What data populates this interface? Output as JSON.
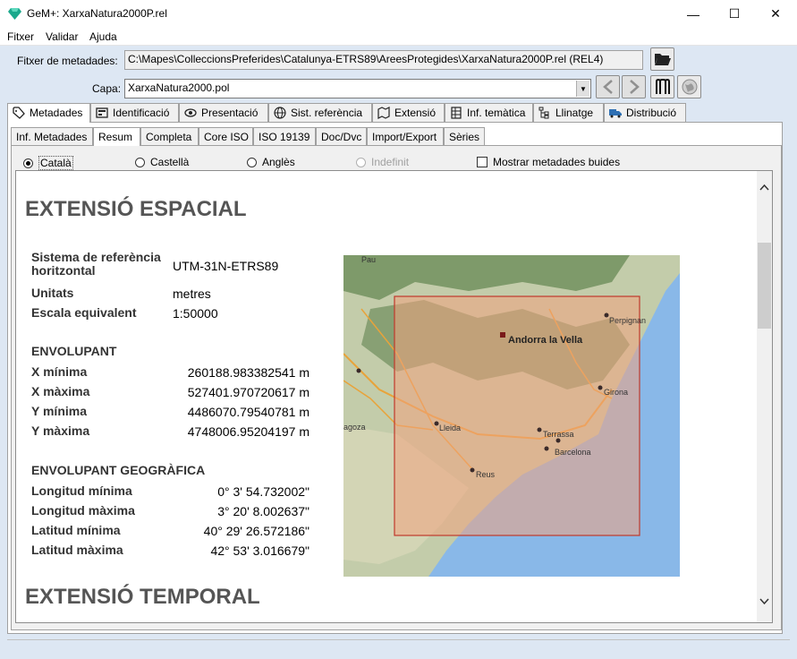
{
  "window": {
    "title": "GeM+: XarxaNatura2000P.rel",
    "minimize": "—",
    "maximize": "☐",
    "close": "✕"
  },
  "menu": [
    "Fitxer",
    "Validar",
    "Ajuda"
  ],
  "metadata_file": {
    "label": "Fitxer de metadades:",
    "value": "C:\\Mapes\\ColleccionsPreferides\\Catalunya-ETRS89\\AreesProtegides\\XarxaNatura2000P.rel (REL4)"
  },
  "layer": {
    "label": "Capa:",
    "value": "XarxaNatura2000.pol"
  },
  "tabs_main": [
    {
      "label": "Metadades",
      "icon": "tag-icon"
    },
    {
      "label": "Identificació",
      "icon": "id-card-icon"
    },
    {
      "label": "Presentació",
      "icon": "eye-icon"
    },
    {
      "label": "Sist. referència",
      "icon": "globe-icon"
    },
    {
      "label": "Extensió",
      "icon": "map-icon"
    },
    {
      "label": "Inf. temàtica",
      "icon": "table-icon"
    },
    {
      "label": "Llinatge",
      "icon": "tree-icon"
    },
    {
      "label": "Distribució",
      "icon": "truck-icon"
    }
  ],
  "tabs_sub": [
    "Inf. Metadades",
    "Resum",
    "Completa",
    "Core ISO",
    "ISO 19139",
    "Doc/Dvc",
    "Import/Export",
    "Sèries"
  ],
  "languages": [
    "Català",
    "Castellà",
    "Anglès",
    "Indefinit"
  ],
  "show_empty": "Mostrar metadades buides",
  "doc": {
    "h_spatial": "EXTENSIÓ ESPACIAL",
    "crs_label": "Sistema de referència horitzontal",
    "crs_value": "UTM-31N-ETRS89",
    "units_label": "Unitats",
    "units_value": "metres",
    "scale_label": "Escala equivalent",
    "scale_value": "1:50000",
    "env_heading": "ENVOLUPANT",
    "xmin_label": "X mínima",
    "xmin_value": "260188.983382541 m",
    "xmax_label": "X màxima",
    "xmax_value": "527401.970720617 m",
    "ymin_label": "Y mínima",
    "ymin_value": "4486070.79540781 m",
    "ymax_label": "Y màxima",
    "ymax_value": "4748006.95204197 m",
    "geo_heading": "ENVOLUPANT GEOGRÀFICA",
    "lonmin_label": "Longitud mínima",
    "lonmin_value": "0° 3' 54.732002\"",
    "lonmax_label": "Longitud màxima",
    "lonmax_value": "3° 20' 8.002637\"",
    "latmin_label": "Latitud mínima",
    "latmin_value": "40° 29' 26.572186\"",
    "latmax_label": "Latitud màxima",
    "latmax_value": "42° 53' 3.016679\"",
    "h_temporal": "EXTENSIÓ TEMPORAL"
  },
  "map_labels": {
    "pau": "Pau",
    "andorra": "Andorra la Vella",
    "perpignan": "Perpignan",
    "girona": "Girona",
    "lleida": "Lleida",
    "terrassa": "Terrassa",
    "barcelona": "Barcelona",
    "reus": "Reus",
    "zaragoza": "agoza"
  }
}
